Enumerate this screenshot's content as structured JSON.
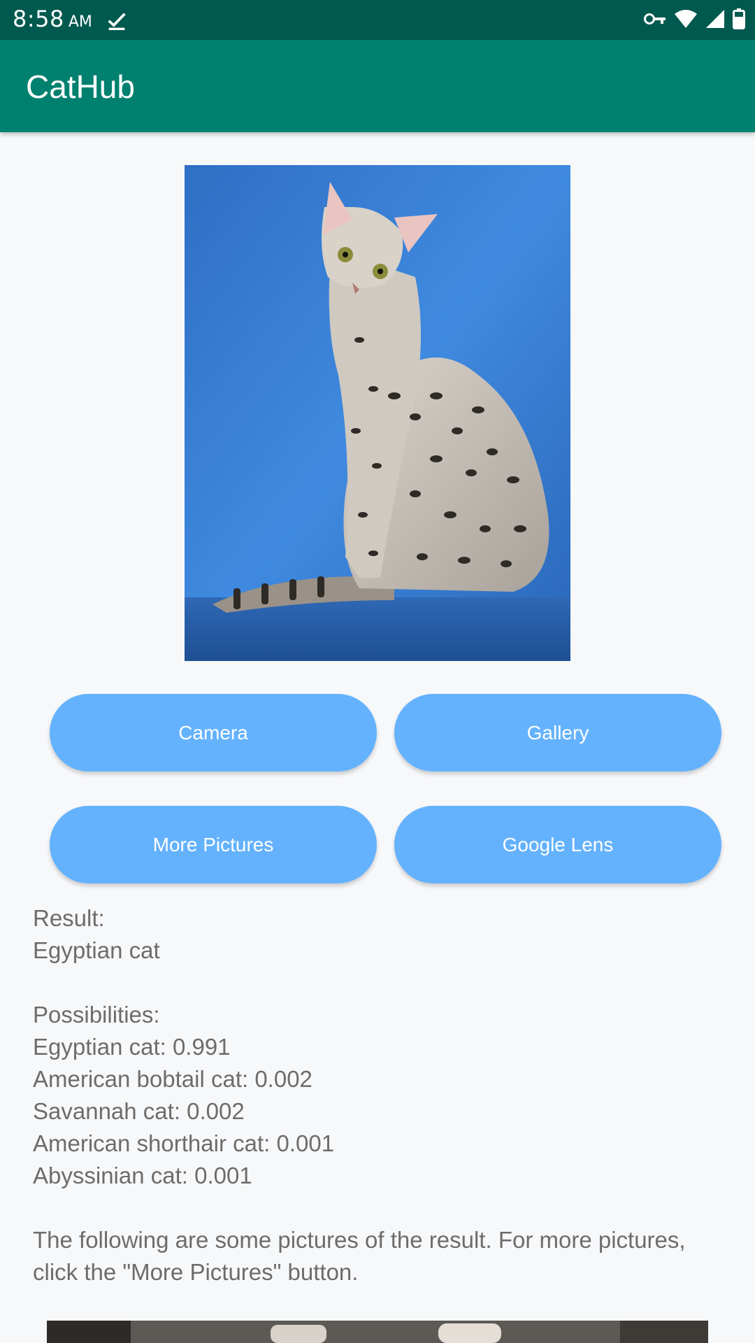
{
  "status_bar": {
    "time": "8:58",
    "ampm": "AM",
    "icons": [
      "download-done-icon",
      "vpn-key-icon",
      "wifi-icon",
      "cell-signal-icon",
      "battery-icon"
    ]
  },
  "app_bar": {
    "title": "CatHub"
  },
  "buttons": {
    "camera": "Camera",
    "gallery": "Gallery",
    "more_pictures": "More Pictures",
    "google_lens": "Google Lens"
  },
  "result": {
    "label": "Result:",
    "value": "Egyptian cat",
    "possibilities_label": "Possibilities:",
    "possibilities": [
      "Egyptian cat: 0.991",
      "American bobtail cat: 0.002",
      "Savannah cat: 0.002",
      "American shorthair cat: 0.001",
      "Abyssinian cat: 0.001"
    ],
    "note": "The following are some pictures of the result. For more pictures, click the \"More Pictures\" button."
  },
  "colors": {
    "status_bar": "#00594e",
    "app_bar": "#00806f",
    "button": "#64b2fd",
    "background": "#f7f8fa",
    "text": "#6c6c6c"
  }
}
